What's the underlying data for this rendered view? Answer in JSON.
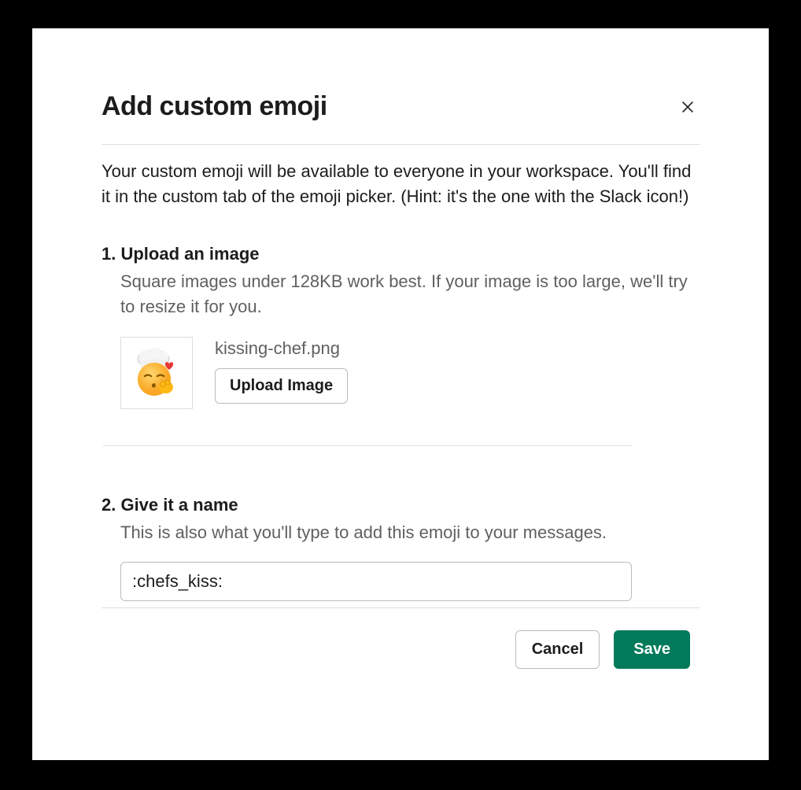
{
  "modal": {
    "title": "Add custom emoji",
    "description": "Your custom emoji will be available to everyone in your workspace. You'll find it in the custom tab of the emoji picker. (Hint: it's the one with the Slack icon!)",
    "step1": {
      "title": "1. Upload an image",
      "hint": "Square images under 128KB work best. If your image is too large, we'll try to resize it for you.",
      "filename": "kissing-chef.png",
      "upload_button": "Upload Image"
    },
    "step2": {
      "title": "2. Give it a name",
      "hint": "This is also what you'll type to add this emoji to your messages.",
      "input_value": ":chefs_kiss:"
    },
    "footer": {
      "cancel": "Cancel",
      "save": "Save"
    }
  }
}
